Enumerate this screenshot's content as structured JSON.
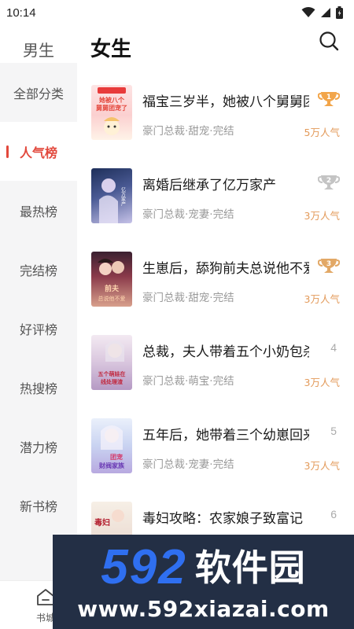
{
  "status_bar": {
    "time": "10:14"
  },
  "header": {
    "gender_male": "男生",
    "gender_female": "女生"
  },
  "sidebar": {
    "items": [
      {
        "label": "全部分类"
      },
      {
        "label": "人气榜"
      },
      {
        "label": "最热榜"
      },
      {
        "label": "完结榜"
      },
      {
        "label": "好评榜"
      },
      {
        "label": "热搜榜"
      },
      {
        "label": "潜力榜"
      },
      {
        "label": "新书榜"
      }
    ],
    "active_index": 1
  },
  "books": [
    {
      "rank": "1",
      "title": "福宝三岁半，她被八个舅舅团宠了",
      "meta": "豪门总裁·甜宠·完结",
      "popularity": "5万人气",
      "cover_text": [
        "她被八个",
        "舅舅团宠了"
      ]
    },
    {
      "rank": "2",
      "title": "离婚后继承了亿万家产",
      "meta": "豪门总裁·宠妻·完结",
      "popularity": "3万人气",
      "cover_text": [
        "亿万家产"
      ]
    },
    {
      "rank": "3",
      "title": "生崽后，舔狗前夫总说他不爱",
      "meta": "豪门总裁·甜宠·完结",
      "popularity": "3万人气",
      "cover_text": [
        "前夫",
        "总说他不爱"
      ]
    },
    {
      "rank": "4",
      "title": "总裁，夫人带着五个小奶包杀回来了",
      "meta": "豪门总裁·萌宝·完结",
      "popularity": "3万人气",
      "cover_text": [
        "五个萌娃在",
        "线处理渣"
      ]
    },
    {
      "rank": "5",
      "title": "五年后，她带着三个幼崽回来了",
      "meta": "豪门总裁·宠妻·完结",
      "popularity": "3万人气",
      "cover_text": [
        "团宠",
        "财阀家族"
      ]
    },
    {
      "rank": "6",
      "title": "毒妇攻略：农家娘子致富记",
      "meta": "",
      "popularity": "",
      "cover_text": [
        "毒妇"
      ]
    }
  ],
  "bottom_nav": {
    "home_label": "书城"
  },
  "watermark": {
    "brand_digits": "592",
    "brand_name": "软件园",
    "url": "www.592xiazai.com"
  },
  "colors": {
    "accent": "#e2483c",
    "popularity": "#e39a5a",
    "gold": "#f2a54a",
    "silver": "#c4c4c4",
    "bronze": "#e2a866",
    "watermark_bg": "#232f45",
    "watermark_blue": "#2f6ff0"
  },
  "icons": {
    "search": "search-icon",
    "wifi": "wifi-icon",
    "signal": "signal-icon",
    "battery": "battery-icon",
    "home": "home-icon",
    "trophy": "trophy-icon"
  }
}
